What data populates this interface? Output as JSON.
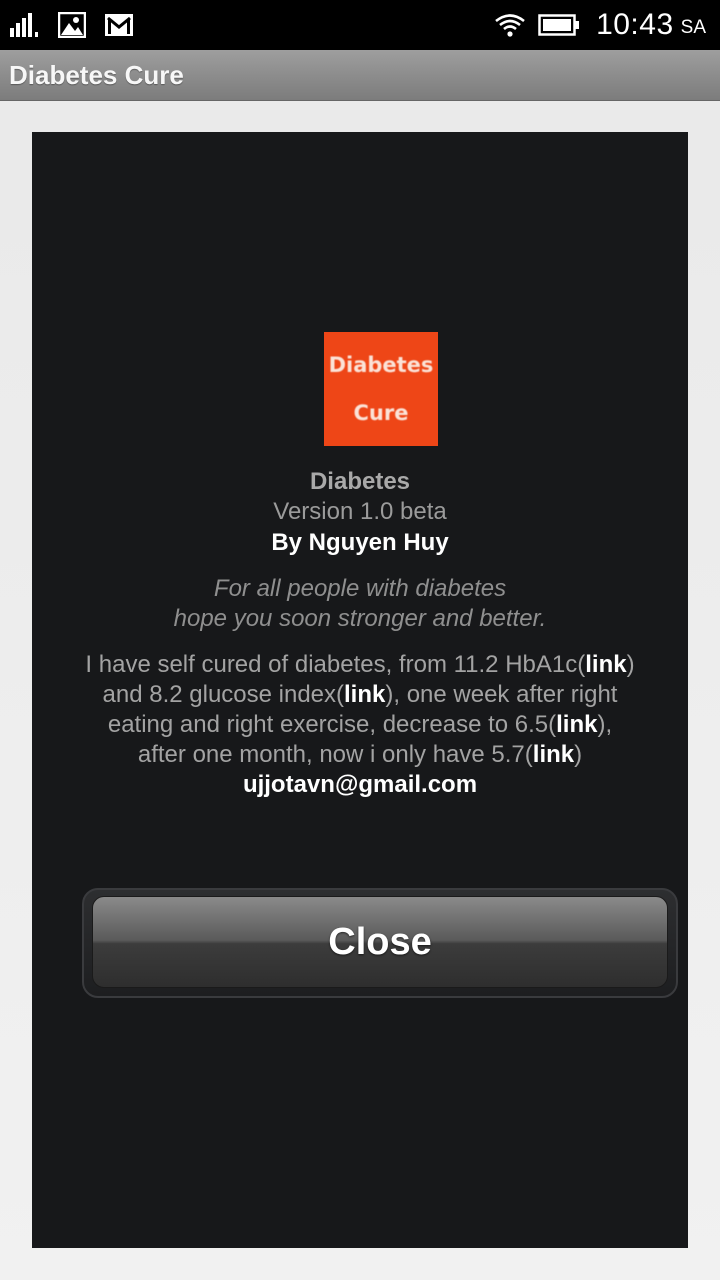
{
  "status_bar": {
    "icons": [
      "signal-icon",
      "gallery-notification-icon",
      "gmail-notification-icon",
      "wifi-icon",
      "battery-icon"
    ],
    "time": "10:43",
    "ampm": "SA"
  },
  "title_bar": {
    "title": "Diabetes Cure"
  },
  "dialog": {
    "logo": {
      "line1": "Diabetes",
      "line2": "Cure",
      "color": "#ee4617"
    },
    "app_name": "Diabetes",
    "version": "Version 1.0 beta",
    "author": "By Nguyen Huy",
    "tagline": {
      "line1": "For all people with diabetes",
      "line2": "hope you soon stronger and better."
    },
    "story": {
      "p1": "I have self cured of diabetes, from 11.2 HbA1c(",
      "link1": "link",
      "p2": ")",
      "p3": "and 8.2 glucose index(",
      "link2": "link",
      "p4": "), one week after right",
      "p5": "eating and right exercise, decrease to 6.5(",
      "link3": "link",
      "p6": "),",
      "p7": "after one month, now i only have 5.7(",
      "link4": "link",
      "p8": ")"
    },
    "email": "ujjotavn@gmail.com",
    "close_label": "Close"
  }
}
